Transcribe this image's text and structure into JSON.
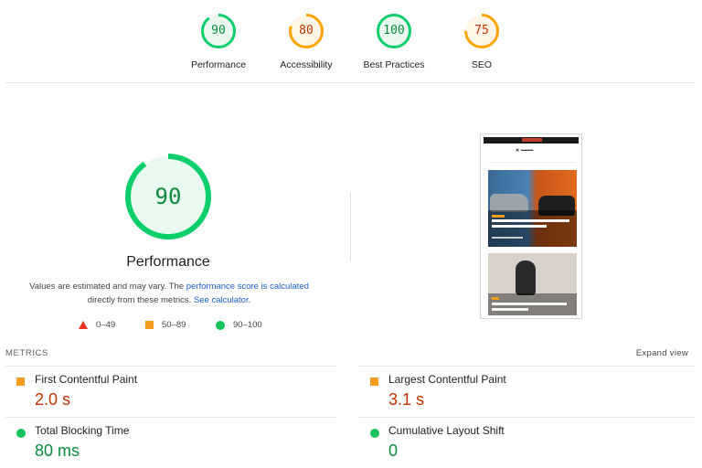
{
  "colors": {
    "pass": "#0cce6b",
    "pass_text": "#0c8a3e",
    "average": "#ffa400",
    "average_text": "#c33300",
    "fail": "#ff4e42"
  },
  "categories": [
    {
      "label": "Performance",
      "score": 90,
      "rating": "pass"
    },
    {
      "label": "Accessibility",
      "score": 80,
      "rating": "average"
    },
    {
      "label": "Best Practices",
      "score": 100,
      "rating": "pass"
    },
    {
      "label": "SEO",
      "score": 75,
      "rating": "average"
    }
  ],
  "main": {
    "score": 90,
    "title": "Performance",
    "desc_before": "Values are estimated and may vary. The ",
    "desc_link": "performance score is calculated",
    "desc_middle": "directly from these metrics. ",
    "desc_link2": "See calculator",
    "desc_after": "."
  },
  "legend": [
    {
      "range": "0–49",
      "icon": "red-triangle-icon"
    },
    {
      "range": "50–89",
      "icon": "orange-square-icon"
    },
    {
      "range": "90–100",
      "icon": "green-circle-icon"
    }
  ],
  "metrics": {
    "header": "METRICS",
    "expand_label": "Expand view",
    "items": [
      {
        "name": "First Contentful Paint",
        "value": "2.0 s",
        "rating": "average"
      },
      {
        "name": "Largest Contentful Paint",
        "value": "3.1 s",
        "rating": "average"
      },
      {
        "name": "Total Blocking Time",
        "value": "80 ms",
        "rating": "pass"
      },
      {
        "name": "Cumulative Layout Shift",
        "value": "0",
        "rating": "pass"
      }
    ]
  }
}
